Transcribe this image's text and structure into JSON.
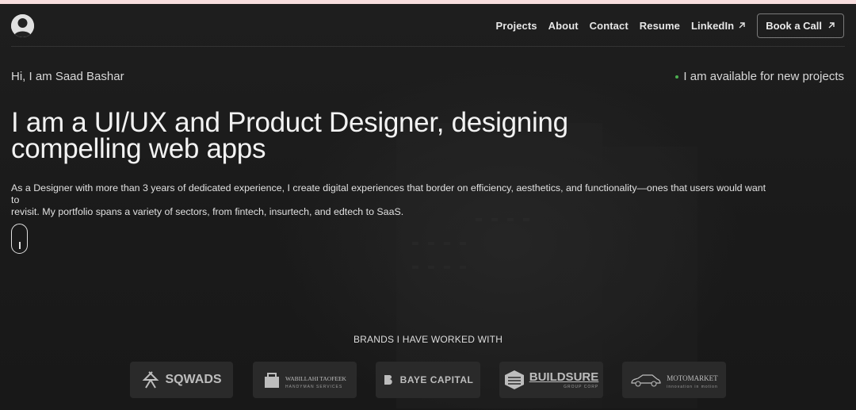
{
  "header": {
    "nav": [
      {
        "label": "Projects"
      },
      {
        "label": "About"
      },
      {
        "label": "Contact"
      },
      {
        "label": "Resume"
      },
      {
        "label": "LinkedIn",
        "icon": "arrow-up-right-icon"
      }
    ],
    "cta_label": "Book a Call",
    "cta_icon": "arrow-up-right-icon"
  },
  "hero": {
    "greeting": "Hi, I am Saad Bashar",
    "availability": "I am available for new projects",
    "availability_color": "#4caf50",
    "headline_line1": "I am a UI/UX and Product Designer, designing",
    "headline_line2": "compelling web apps",
    "bio_line1": "As a Designer with more than 3 years of dedicated experience, I create digital experiences that border on efficiency, aesthetics, and functionality—ones that users would want to",
    "bio_line2": "revisit. My portfolio spans a variety of sectors, from fintech, insurtech, and edtech to SaaS."
  },
  "brands": {
    "title": "BRANDS I HAVE WORKED WITH",
    "items": [
      {
        "name": "SQWADS",
        "sub": ""
      },
      {
        "name": "WABILLAHI TAOFEEK",
        "sub": "HANDYMAN SERVICES"
      },
      {
        "name": "BAYE CAPITAL",
        "sub": ""
      },
      {
        "name": "BUILDSURE",
        "sub": "GROUP CORP"
      },
      {
        "name": "MOTOMARKET",
        "sub": "innovation in motion"
      }
    ]
  },
  "colors": {
    "background": "#1c1c1c",
    "top_strip": "#f7dede",
    "text": "#e8e8e8"
  }
}
